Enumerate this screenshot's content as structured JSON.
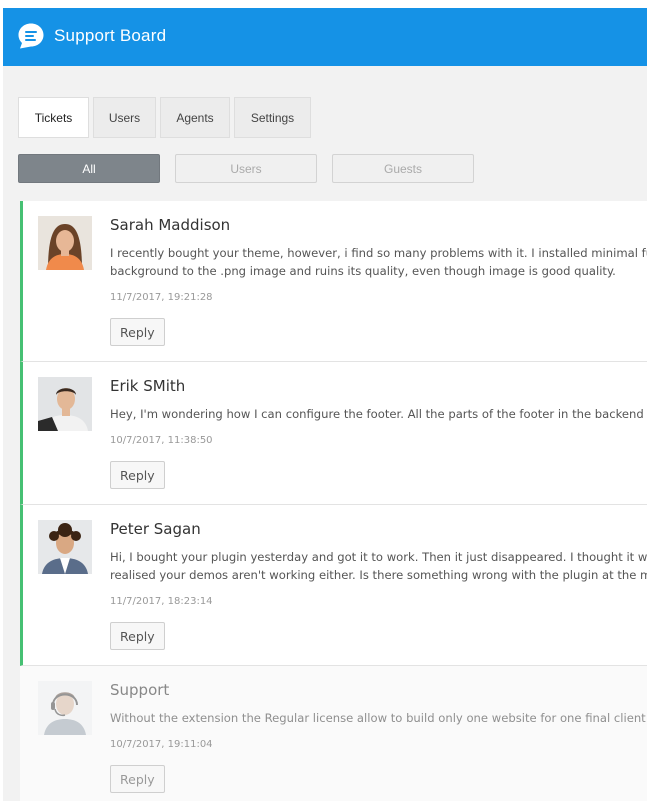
{
  "header": {
    "title": "Support Board",
    "logo_icon": "chat-bubble-icon",
    "color": "#1592e6"
  },
  "tabs": [
    {
      "label": "Tickets",
      "active": true
    },
    {
      "label": "Users",
      "active": false
    },
    {
      "label": "Agents",
      "active": false
    },
    {
      "label": "Settings",
      "active": false
    }
  ],
  "filters": [
    {
      "label": "All",
      "active": true
    },
    {
      "label": "Users",
      "active": false
    },
    {
      "label": "Guests",
      "active": false
    }
  ],
  "tickets": [
    {
      "name": "Sarah Maddison",
      "message_lines": [
        "I recently bought your theme, however, i find so many problems with it. I installed minimal full",
        "background to the .png image and ruins its quality, even though image is good quality."
      ],
      "time": "11/7/2017, 19:21:28",
      "reply_label": "Reply"
    },
    {
      "name": "Erik SMith",
      "message_lines": [
        "Hey, I'm wondering how I can configure the footer. All the parts of the footer in the backend a"
      ],
      "time": "10/7/2017, 11:38:50",
      "reply_label": "Reply"
    },
    {
      "name": "Peter Sagan",
      "message_lines": [
        "Hi, I bought your plugin yesterday and got it to work. Then it just disappeared. I thought it wa",
        "realised your demos aren't working either. Is there something wrong with the plugin at the mo"
      ],
      "time": "11/7/2017, 18:23:14",
      "reply_label": "Reply"
    },
    {
      "name": "Support",
      "message_lines": [
        "Without the extension the Regular license allow to build only one website for one final client. A"
      ],
      "time": "10/7/2017, 19:11:04",
      "reply_label": "Reply"
    }
  ],
  "colors": {
    "accent": "#1592e6",
    "open_marker": "#46c073",
    "active_filter": "#7e858b"
  }
}
